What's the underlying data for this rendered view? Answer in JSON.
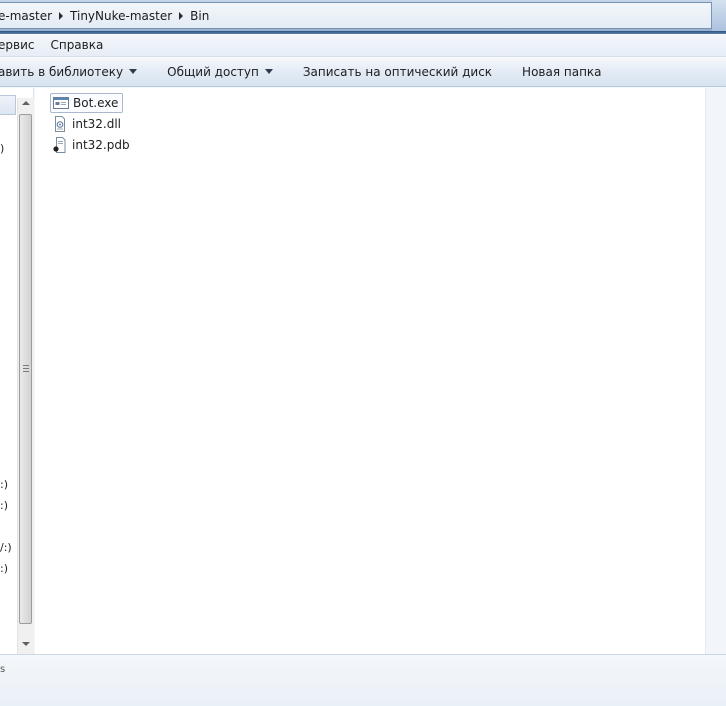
{
  "breadcrumb": {
    "items": [
      "e-master",
      "TinyNuke-master",
      "Bin"
    ]
  },
  "menu": {
    "items": [
      "ервис",
      "Справка"
    ]
  },
  "toolbar": {
    "add_to_library": "авить в библиотеку",
    "share": "Общий доступ",
    "burn": "Записать на оптический диск",
    "new_folder": "Новая папка"
  },
  "nav": {
    "fragments": [
      ")",
      ":)",
      ":)",
      "/:)",
      ":)"
    ]
  },
  "files": [
    {
      "name": "Bot.exe",
      "icon": "exe-icon",
      "selected": true
    },
    {
      "name": "int32.dll",
      "icon": "dll-icon",
      "selected": false
    },
    {
      "name": "int32.pdb",
      "icon": "pdb-icon",
      "selected": false
    }
  ],
  "details": {
    "fragment": "s"
  }
}
